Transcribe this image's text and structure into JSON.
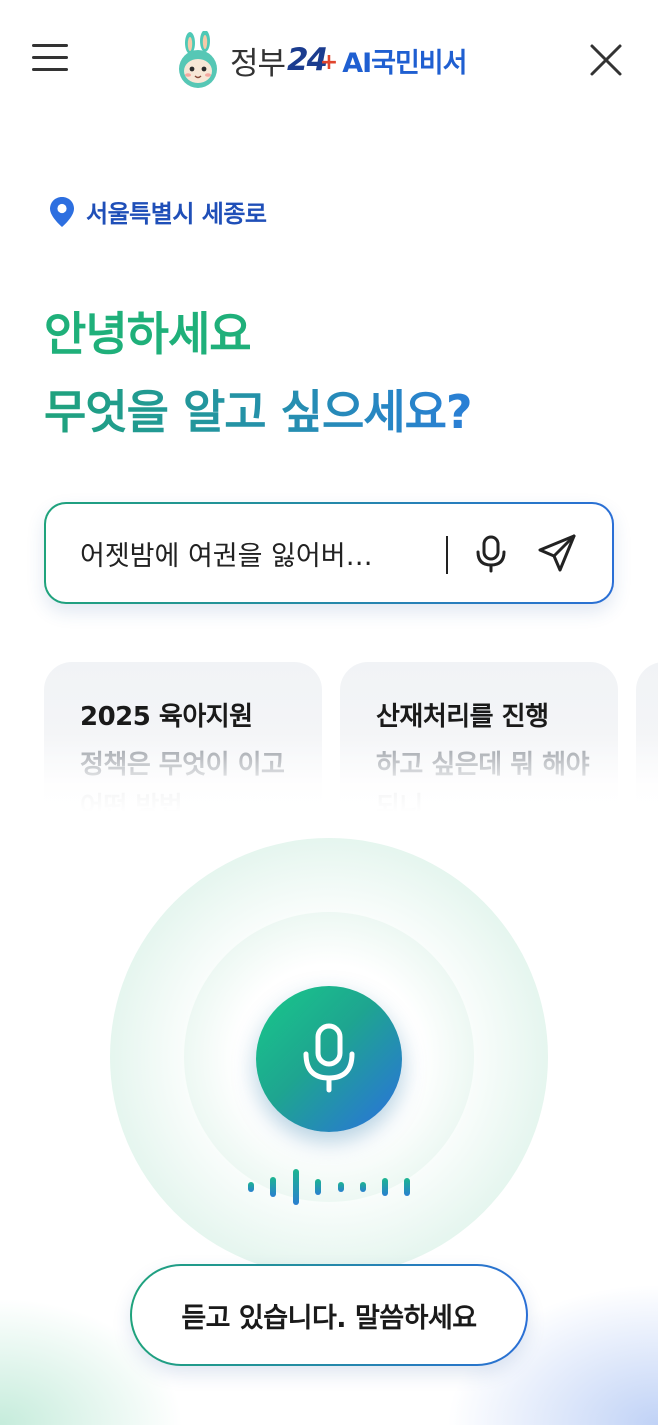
{
  "header": {
    "menu_icon": "hamburger-menu-icon",
    "logo": {
      "brand": "정부",
      "number": "24",
      "plus": "+",
      "product": "AI국민비서",
      "mascot_icon": "rabbit-mascot-icon"
    },
    "close_icon": "close-icon"
  },
  "location": {
    "icon": "map-pin-icon",
    "label": "서울특별시 세종로",
    "color": "#1f4fb8"
  },
  "greeting": {
    "line1": "안녕하세요",
    "line2": "무엇을 알고 싶으세요?"
  },
  "search": {
    "value": "어젯밤에 여권을 잃어버…",
    "mic_icon": "microphone-icon",
    "send_icon": "send-paper-plane-icon"
  },
  "suggestions": [
    {
      "title": "2025 육아지원",
      "body": "정책은 무엇이 이고 어떤 방법"
    },
    {
      "title": "산재처리를 진행",
      "body": "하고 싶은데 뭐 해야 되니"
    }
  ],
  "voice": {
    "mic_icon": "microphone-icon",
    "waveform_icon": "audio-waveform-icon",
    "status": "듣고 있습니다. 말씀하세요"
  },
  "colors": {
    "accent_green": "#1fb07a",
    "accent_blue": "#2a6fd6"
  }
}
